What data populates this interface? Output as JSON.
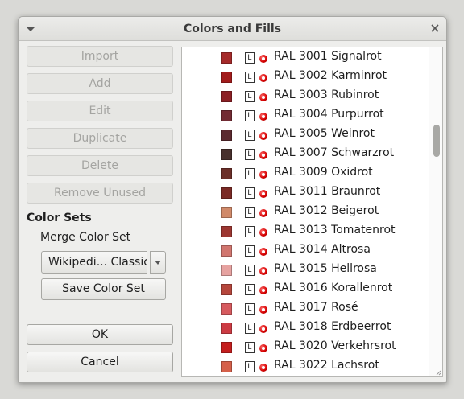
{
  "window": {
    "title": "Colors and Fills"
  },
  "buttons": {
    "import": "Import",
    "add": "Add",
    "edit": "Edit",
    "duplicate": "Duplicate",
    "delete": "Delete",
    "remove_unused": "Remove Unused",
    "ok": "OK",
    "cancel": "Cancel"
  },
  "color_sets": {
    "heading": "Color Sets",
    "merge_label": "Merge Color Set",
    "selected_set": "Wikipedi... Classic",
    "save_label": "Save Color Set"
  },
  "colors": [
    {
      "name": "RAL 3001 Signalrot",
      "hex": "#a52a2a",
      "tag": "L"
    },
    {
      "name": "RAL 3002 Karminrot",
      "hex": "#a21b1b",
      "tag": "L"
    },
    {
      "name": "RAL 3003 Rubinrot",
      "hex": "#8b1f24",
      "tag": "L"
    },
    {
      "name": "RAL 3004 Purpurrot",
      "hex": "#722b33",
      "tag": "L"
    },
    {
      "name": "RAL 3005 Weinrot",
      "hex": "#5b2a2f",
      "tag": "L"
    },
    {
      "name": "RAL 3007 Schwarzrot",
      "hex": "#47302c",
      "tag": "L"
    },
    {
      "name": "RAL 3009 Oxidrot",
      "hex": "#6b2f29",
      "tag": "L"
    },
    {
      "name": "RAL 3011 Braunrot",
      "hex": "#7a2a25",
      "tag": "L"
    },
    {
      "name": "RAL 3012 Beigerot",
      "hex": "#d08a6a",
      "tag": "L"
    },
    {
      "name": "RAL 3013 Tomatenrot",
      "hex": "#9c3631",
      "tag": "L"
    },
    {
      "name": "RAL 3014 Altrosa",
      "hex": "#d1766f",
      "tag": "L"
    },
    {
      "name": "RAL 3015 Hellrosa",
      "hex": "#e6a2a0",
      "tag": "L"
    },
    {
      "name": "RAL 3016 Korallenrot",
      "hex": "#b5463c",
      "tag": "L"
    },
    {
      "name": "RAL 3017 Rosé",
      "hex": "#d65a5e",
      "tag": "L"
    },
    {
      "name": "RAL 3018 Erdbeerrot",
      "hex": "#cc3b43",
      "tag": "L"
    },
    {
      "name": "RAL 3020 Verkehrsrot",
      "hex": "#c41e1e",
      "tag": "L"
    },
    {
      "name": "RAL 3022 Lachsrot",
      "hex": "#d5604a",
      "tag": "L"
    }
  ]
}
